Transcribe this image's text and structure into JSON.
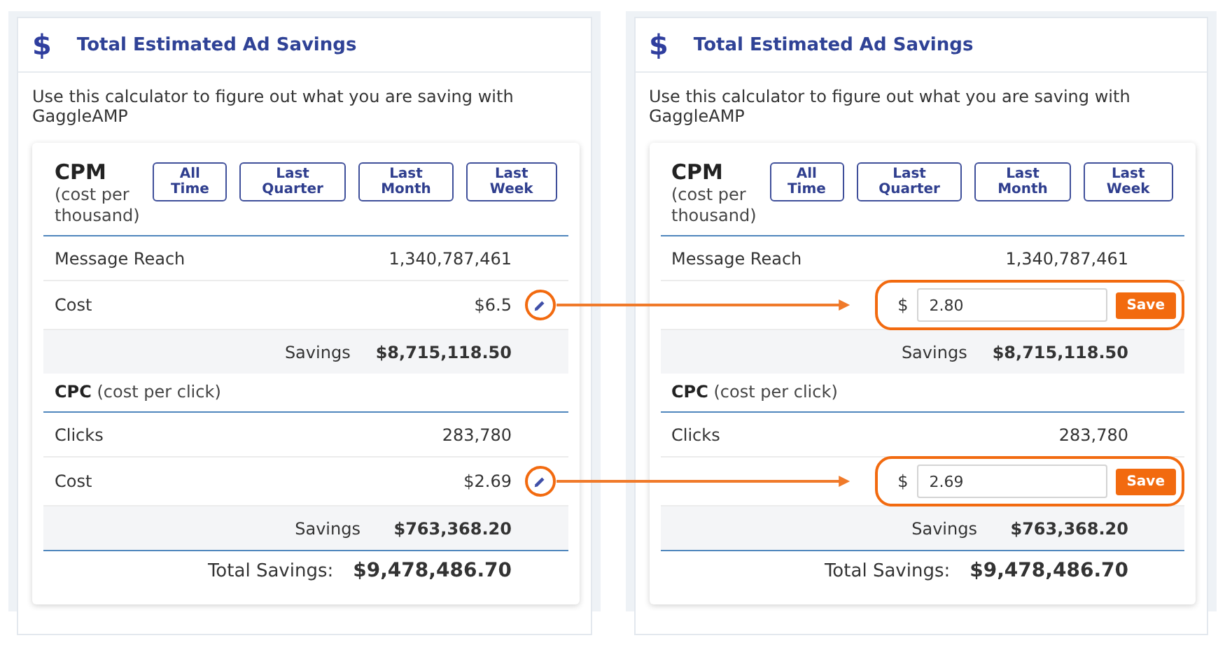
{
  "panels": [
    {
      "icon_glyph": "$",
      "title": "Total Estimated Ad Savings",
      "intro": "Use this calculator to figure out what you are saving with GaggleAMP",
      "sections": [
        {
          "heading": "**CPM** (cost per thousand)",
          "range_buttons": [
            "All Time",
            "Last Quarter",
            "Last Month",
            "Last Week"
          ],
          "rows": [
            {
              "kind": "value",
              "label": "Message Reach",
              "value": "1,340,787,461"
            },
            {
              "kind": "cost",
              "label": "Cost",
              "value": "$6.5",
              "highlighted": true
            }
          ],
          "savings": {
            "label": "Savings",
            "value": "$8,715,118.50"
          }
        },
        {
          "heading": "**CPC** (cost per click)",
          "rows": [
            {
              "kind": "value",
              "label": "Clicks",
              "value": "283,780"
            },
            {
              "kind": "cost",
              "label": "Cost",
              "value": "$2.69",
              "highlighted": true
            }
          ],
          "savings": {
            "label": "Savings",
            "value": "$763,368.20"
          }
        }
      ],
      "total": {
        "label": "Total Savings:",
        "value": "$9,478,486.70"
      }
    },
    {
      "icon_glyph": "$",
      "title": "Total Estimated Ad Savings",
      "intro": "Use this calculator to figure out what you are saving with GaggleAMP",
      "sections": [
        {
          "heading": "**CPM** (cost per thousand)",
          "range_buttons": [
            "All Time",
            "Last Quarter",
            "Last Month",
            "Last Week"
          ],
          "rows": [
            {
              "kind": "value",
              "label": "Message Reach",
              "value": "1,340,787,461"
            },
            {
              "kind": "edit",
              "currency": "$",
              "value": "2.80",
              "save": "Save",
              "highlighted": true
            }
          ],
          "savings": {
            "label": "Savings",
            "value": "$8,715,118.50"
          }
        },
        {
          "heading": "**CPC** (cost per click)",
          "rows": [
            {
              "kind": "value",
              "label": "Clicks",
              "value": "283,780"
            },
            {
              "kind": "edit",
              "currency": "$",
              "value": "2.69",
              "save": "Save",
              "highlighted": true
            }
          ],
          "savings": {
            "label": "Savings",
            "value": "$763,368.20"
          }
        }
      ],
      "total": {
        "label": "Total Savings:",
        "value": "$9,478,486.70"
      }
    }
  ]
}
